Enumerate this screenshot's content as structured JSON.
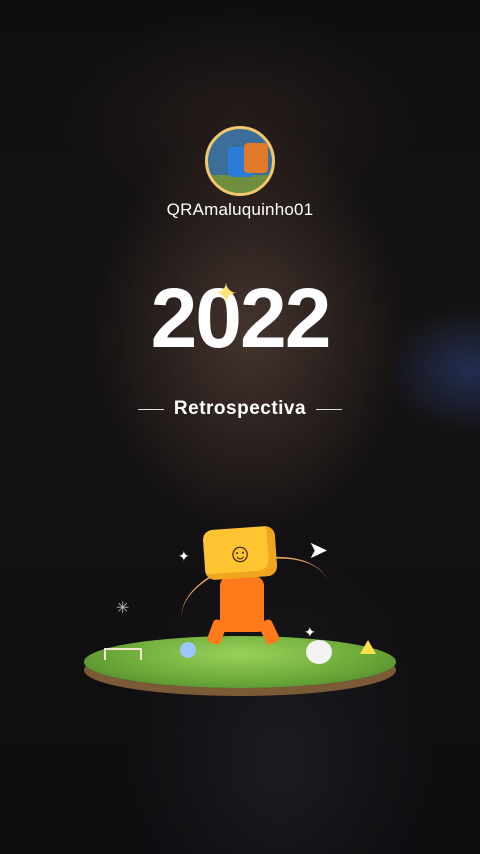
{
  "profile": {
    "username": "QRAmaluquinho01",
    "avatar_icon": "truck-avatar-icon"
  },
  "recap": {
    "year": "2022",
    "subtitle": "Retrospectiva",
    "sparkle_icon": "sparkle-icon"
  },
  "scene": {
    "mascot_icon": "mascot-illustration",
    "face_glyph": "☺",
    "plane_glyph": "➤",
    "star_glyph": "✦"
  },
  "colors": {
    "avatar_ring": "#f2c86a",
    "mascot_head": "#ffc430",
    "mascot_body": "#ff7a1a",
    "grass": "#6cab3a"
  }
}
